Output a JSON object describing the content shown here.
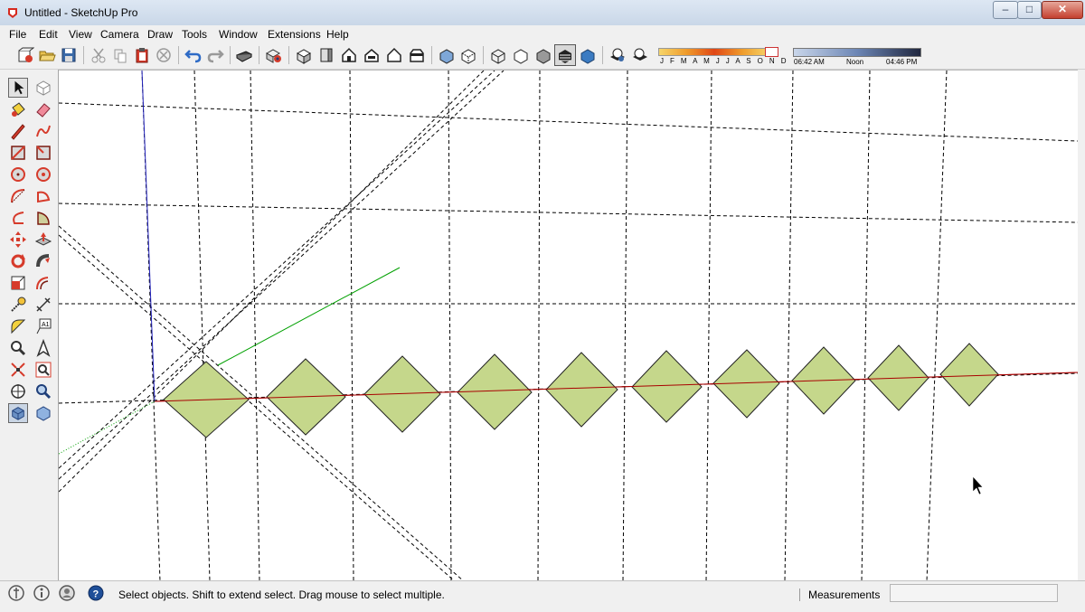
{
  "window": {
    "title": "Untitled - SketchUp Pro",
    "minimize_glyph": "–",
    "maximize_glyph": "□",
    "close_glyph": "✕"
  },
  "menu": [
    "File",
    "Edit",
    "View",
    "Camera",
    "Draw",
    "Tools",
    "Window",
    "Extensions",
    "Help"
  ],
  "toolbar": {
    "icons": [
      "new-model",
      "open",
      "save",
      "cut",
      "copy",
      "paste",
      "erase",
      "undo",
      "redo",
      "print",
      "model-info",
      "iso-view",
      "top-view",
      "front-view",
      "right-view",
      "back-view",
      "left-view",
      "xray",
      "back-edges",
      "wireframe",
      "hidden-line",
      "shaded",
      "shaded-with-textures",
      "monochrome",
      "shadows-toggle",
      "fog-toggle"
    ],
    "shadow_months": "J F M A M J J A S O N D",
    "time_start": "06:42 AM",
    "time_noon": "Noon",
    "time_end": "04:46 PM"
  },
  "tools": [
    "select",
    "make-component",
    "paint-bucket",
    "eraser",
    "line",
    "freehand",
    "rectangle",
    "rotated-rectangle",
    "circle",
    "polygon",
    "arc",
    "pie",
    "2-point-arc",
    "3-point-arc",
    "move",
    "push-pull",
    "rotate",
    "follow-me",
    "scale",
    "offset",
    "tape-measure",
    "dimension",
    "protractor",
    "text",
    "orbit",
    "pan",
    "zoom-extents",
    "zoom-window",
    "position-camera",
    "look-around",
    "walk",
    "section-plane"
  ],
  "active_tool": "select",
  "colors": {
    "face": "#c5d78b",
    "x_axis": "#b30000",
    "y_axis": "#00a000",
    "z_axis": "#0000c0",
    "guide": "#000000"
  },
  "status": {
    "message": "Select objects. Shift to extend select. Drag mouse to select multiple.",
    "measurements_label": "Measurements",
    "measurements_value": ""
  }
}
